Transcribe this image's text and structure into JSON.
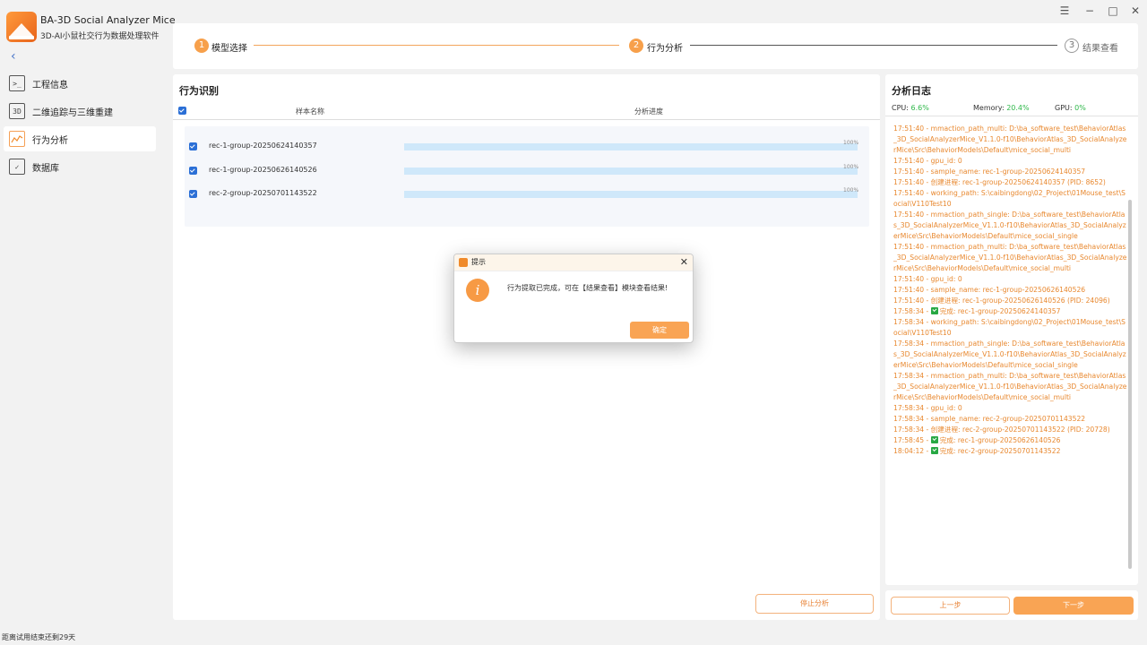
{
  "app": {
    "title": "BA-3D Social Analyzer Mice",
    "subtitle": "3D-AI小鼠社交行为数据处理软件",
    "trial_notice": "距离试用结束还剩29天"
  },
  "sidebar": {
    "items": [
      {
        "label": "工程信息",
        "icon": "terminal-icon"
      },
      {
        "label": "二维追踪与三维重建",
        "icon": "3d-box-icon"
      },
      {
        "label": "行为分析",
        "icon": "chart-analysis-icon"
      },
      {
        "label": "数据库",
        "icon": "database-checklist-icon"
      }
    ]
  },
  "stepper": {
    "steps": [
      {
        "num": "1",
        "label": "模型选择",
        "state": "done"
      },
      {
        "num": "2",
        "label": "行为分析",
        "state": "active"
      },
      {
        "num": "3",
        "label": "结果查看",
        "state": "pending"
      }
    ]
  },
  "behavior": {
    "title": "行为识别",
    "col_name": "样本名称",
    "col_progress": "分析进度",
    "rows": [
      {
        "name": "rec-1-group-20250624140357",
        "progress": "100%",
        "fraction": 1.0
      },
      {
        "name": "rec-1-group-20250626140526",
        "progress": "100%",
        "fraction": 1.0
      },
      {
        "name": "rec-2-group-20250701143522",
        "progress": "100%",
        "fraction": 1.0
      }
    ],
    "stop_button": "停止分析"
  },
  "log": {
    "title": "分析日志",
    "cpu_label": "CPU:",
    "cpu_value": "6.6%",
    "mem_label": "Memory:",
    "mem_value": "20.4%",
    "gpu_label": "GPU:",
    "gpu_value": "0%",
    "lines": [
      "17:51:40 - mmaction_path_multi: D:\\ba_software_test\\BehaviorAtlas_3D_SocialAnalyzerMice_V1.1.0-f10\\BehaviorAtlas_3D_SocialAnalyzerMice\\Src\\BehaviorModels\\Default\\mice_social_multi",
      "17:51:40 - gpu_id: 0",
      "17:51:40 - sample_name: rec-1-group-20250624140357",
      "17:51:40 - 创建进程: rec-1-group-20250624140357 (PID: 8652)",
      "17:51:40 - working_path: S:\\caibingdong\\02_Project\\01Mouse_test\\Social\\V110Test10",
      "17:51:40 - mmaction_path_single: D:\\ba_software_test\\BehaviorAtlas_3D_SocialAnalyzerMice_V1.1.0-f10\\BehaviorAtlas_3D_SocialAnalyzerMice\\Src\\BehaviorModels\\Default\\mice_social_single",
      "17:51:40 - mmaction_path_multi: D:\\ba_software_test\\BehaviorAtlas_3D_SocialAnalyzerMice_V1.1.0-f10\\BehaviorAtlas_3D_SocialAnalyzerMice\\Src\\BehaviorModels\\Default\\mice_social_multi",
      "17:51:40 - gpu_id: 0",
      "17:51:40 - sample_name: rec-1-group-20250626140526",
      "17:51:40 - 创建进程: rec-1-group-20250626140526 (PID: 24096)",
      "17:58:34 - [ok] 完成: rec-1-group-20250624140357",
      "17:58:34 - working_path: S:\\caibingdong\\02_Project\\01Mouse_test\\Social\\V110Test10",
      "17:58:34 - mmaction_path_single: D:\\ba_software_test\\BehaviorAtlas_3D_SocialAnalyzerMice_V1.1.0-f10\\BehaviorAtlas_3D_SocialAnalyzerMice\\Src\\BehaviorModels\\Default\\mice_social_single",
      "17:58:34 - mmaction_path_multi: D:\\ba_software_test\\BehaviorAtlas_3D_SocialAnalyzerMice_V1.1.0-f10\\BehaviorAtlas_3D_SocialAnalyzerMice\\Src\\BehaviorModels\\Default\\mice_social_multi",
      "17:58:34 - gpu_id: 0",
      "17:58:34 - sample_name: rec-2-group-20250701143522",
      "17:58:34 - 创建进程: rec-2-group-20250701143522 (PID: 20728)",
      "17:58:45 - [ok] 完成: rec-1-group-20250626140526",
      "18:04:12 - [ok] 完成: rec-2-group-20250701143522"
    ],
    "prev_button": "上一步",
    "next_button": "下一步"
  },
  "dialog": {
    "title": "提示",
    "message": "行为提取已完成，可在【结果查看】模块查看结果!",
    "ok_button": "确定"
  },
  "colors": {
    "accent": "#f7a04b",
    "log_text": "#e8882f",
    "ok_green": "#27a844",
    "checkbox_blue": "#2b6fd6"
  }
}
